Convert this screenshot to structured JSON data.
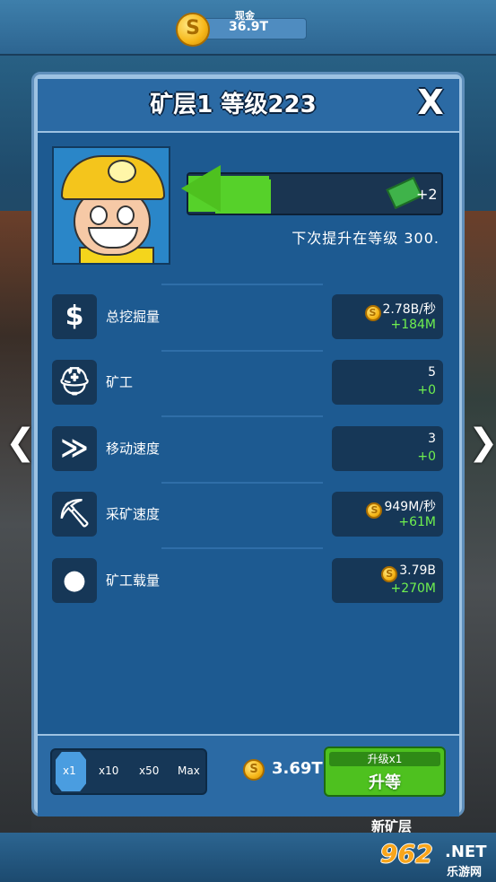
{
  "header": {
    "cash_label": "现金",
    "cash_value": "36.9T",
    "coin_glyph": "S"
  },
  "dialog": {
    "title": "矿层1 等级223",
    "close_label": "X",
    "progress": {
      "fill_fraction": 0.32,
      "reward": "+2",
      "next_upgrade_text": "下次提升在等级 300."
    },
    "stats": [
      {
        "label": "总挖掘量",
        "icon": "dollar-icon",
        "glyph": "$",
        "value": "2.78B/秒",
        "increase": "+184M",
        "has_coin": true
      },
      {
        "label": "矿工",
        "icon": "miner-icon",
        "glyph": "⛑",
        "value": "5",
        "increase": "+0",
        "has_coin": false
      },
      {
        "label": "移动速度",
        "icon": "boot-speed-icon",
        "glyph": "≫",
        "value": "3",
        "increase": "+0",
        "has_coin": false
      },
      {
        "label": "采矿速度",
        "icon": "pickaxe-icon",
        "glyph": "⛏",
        "value": "949M/秒",
        "increase": "+61M",
        "has_coin": true
      },
      {
        "label": "矿工载量",
        "icon": "sack-icon",
        "glyph": "●",
        "value": "3.79B",
        "increase": "+270M",
        "has_coin": true
      }
    ],
    "multiplier": {
      "options": [
        "x1",
        "x10",
        "x50",
        "Max"
      ],
      "selected": "x1"
    },
    "cost": "3.69T",
    "upgrade_sub_label": "升级x1",
    "upgrade_label": "升等"
  },
  "navigation": {
    "prev_arrow": "❮",
    "next_arrow": "❯"
  },
  "footer": {
    "new_layer_label": "新矿层"
  },
  "watermark": {
    "number": "962",
    "suffix": ".NET",
    "chinese": "乐游网"
  },
  "colors": {
    "panel_blue": "#1d5a91",
    "progress_green": "#56d12a",
    "increase_green": "#6ff04f",
    "coin_gold": "#f6b617"
  }
}
